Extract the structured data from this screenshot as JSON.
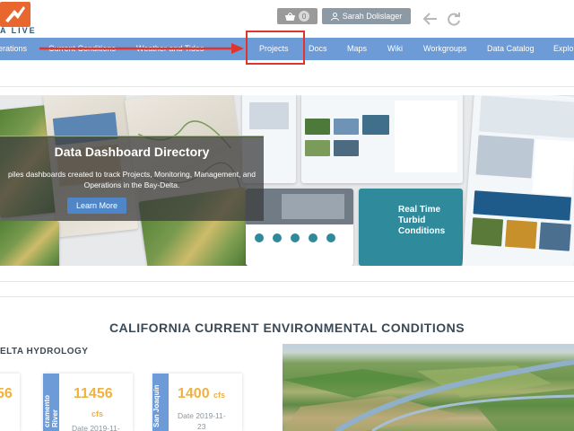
{
  "header": {
    "logo_text": "A LIVE",
    "cart_count": "0",
    "user_name": "Sarah Dolislager"
  },
  "nav": {
    "items": [
      "erations",
      "Current Conditions",
      "Weather and Tides",
      "Projects",
      "Docs",
      "Maps",
      "Wiki",
      "Workgroups",
      "Data Catalog",
      "Explo"
    ]
  },
  "hero": {
    "title": "Data Dashboard Directory",
    "description_line1": "piles dashboards created to track Projects, Monitoring, Management, and",
    "description_line2": "Operations in the Bay-Delta.",
    "button_label": "Learn More",
    "shot_title": "Real Time Turbid Conditions"
  },
  "section": {
    "title": "CALIFORNIA CURRENT ENVIRONMENTAL CONDITIONS",
    "subtitle": "ELTA HYDROLOGY"
  },
  "cards": [
    {
      "tab": "",
      "value": "56",
      "unit": "",
      "date": ""
    },
    {
      "tab": "cramento River",
      "value": "11456",
      "unit": "cfs",
      "date": "Date 2019-11-"
    },
    {
      "tab": "San Joaquin",
      "value": "1400",
      "unit": "cfs",
      "date": "Date 2019-11-",
      "date2": "23"
    }
  ],
  "colors": {
    "navbar": "#6d9bd8",
    "accent_red": "#e0352a",
    "value_gold": "#f0b23d",
    "logo_orange": "#e8672e"
  }
}
